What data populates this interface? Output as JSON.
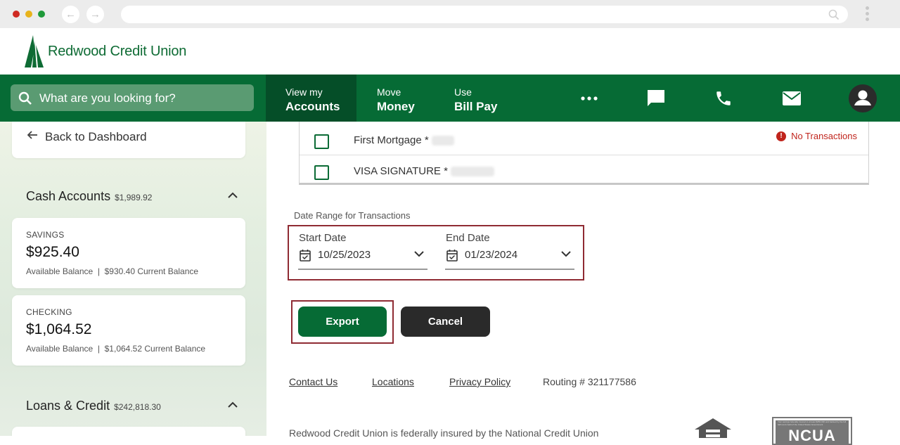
{
  "brand": {
    "name": "Redwood Credit Union",
    "color_primary": "#066b35",
    "color_dark": "#054e28",
    "color_highlight": "#8f2b33",
    "color_error": "#c0241c"
  },
  "browser": {
    "back_glyph": "←",
    "forward_glyph": "→"
  },
  "nav": {
    "search_placeholder": "What are you looking for?",
    "tabs": [
      {
        "small": "View my",
        "big": "Accounts",
        "active": true
      },
      {
        "small": "Move",
        "big": "Money",
        "active": false
      },
      {
        "small": "Use",
        "big": "Bill Pay",
        "active": false
      }
    ],
    "icons": [
      "more-icon",
      "chat-icon",
      "phone-icon",
      "mail-icon",
      "profile-icon"
    ]
  },
  "sidebar": {
    "back_label": "Back to Dashboard",
    "cash_section": {
      "title": "Cash Accounts",
      "amount": "$1,989.92"
    },
    "accounts": [
      {
        "label": "SAVINGS",
        "balance": "$925.40",
        "sub": "Available Balance  |  $930.40 Current Balance"
      },
      {
        "label": "CHECKING",
        "balance": "$1,064.52",
        "sub": "Available Balance  |  $1,064.52 Current Balance"
      }
    ],
    "loans_section": {
      "title": "Loans & Credit",
      "amount": "$242,818.30"
    }
  },
  "export_accounts": [
    {
      "name": "First Mortgage *",
      "status": "No Transactions",
      "checked": false
    },
    {
      "name": "VISA SIGNATURE *",
      "status": "",
      "checked": false
    }
  ],
  "date_range": {
    "label": "Date Range for Transactions",
    "start_label": "Start Date",
    "start_value": "10/25/2023",
    "end_label": "End Date",
    "end_value": "01/23/2024"
  },
  "actions": {
    "export_label": "Export",
    "cancel_label": "Cancel"
  },
  "footer": {
    "contact": "Contact Us",
    "locations": "Locations",
    "privacy": "Privacy Policy",
    "routing": "Routing # 321177586",
    "insured_text": "Redwood Credit Union is federally insured by the National Credit Union",
    "ncua_word": "NCUA",
    "ncua_fine": "Your savings federally insured to at least $250,000 and backed by the full faith and credit of the United States Government"
  }
}
